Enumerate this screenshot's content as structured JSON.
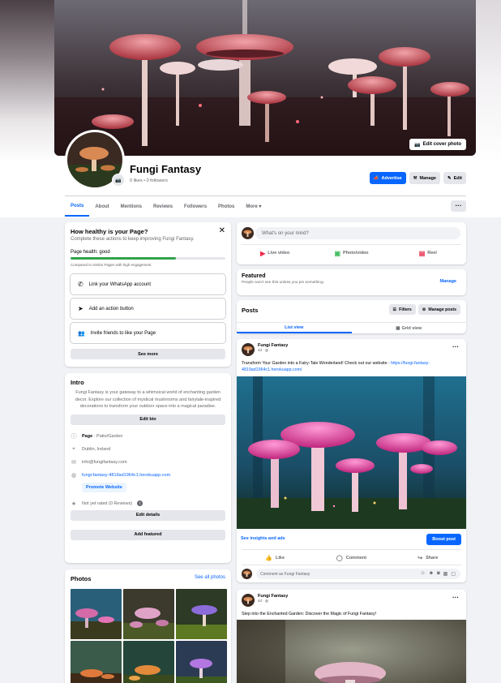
{
  "page": {
    "name": "Fungi Fantasy",
    "stats": "0 likes • 0 followers",
    "edit_cover": "Edit cover photo"
  },
  "header_buttons": {
    "advertise": "Advertise",
    "manage": "Manage",
    "edit": "Edit"
  },
  "tabs": [
    "Posts",
    "About",
    "Mentions",
    "Reviews",
    "Followers",
    "Photos",
    "More"
  ],
  "health": {
    "title": "How healthy is your Page?",
    "subtitle": "Complete these actions to keep improving Fungi Fantasy.",
    "status": "Page health: good",
    "level": 0.68,
    "compare": "Compared to similar Pages with high engagement",
    "actions": [
      "Link your WhatsApp account",
      "Add an action button",
      "Invite friends to like your Page"
    ],
    "see_more": "See more"
  },
  "intro": {
    "title": "Intro",
    "bio": "Fungi Fantasy is your gateway to a whimsical world of enchanting garden decor. Explore our collection of mystical mushrooms and fairytale-inspired decorations to transform your outdoor space into a magical paradise.",
    "edit_bio": "Edit bio",
    "category_label": "Page",
    "category": "Patio/Garden",
    "location": "Dublin, Ireland",
    "email": "info@fungifantasy.com",
    "website": "fungi-fantasy-4819ad1964c1.herokuapp.com",
    "promote": "Promote Website",
    "rating": "Not yet rated (0 Reviews)",
    "edit_details": "Edit details",
    "add_featured": "Add featured"
  },
  "photos": {
    "title": "Photos",
    "see_all": "See all photos"
  },
  "composer": {
    "placeholder": "What's on your mind?",
    "live": "Live video",
    "photo": "Photo/video",
    "reel": "Reel"
  },
  "featured": {
    "title": "Featured",
    "subtitle": "People won't see this unless you pin something.",
    "manage": "Manage"
  },
  "posts_header": {
    "title": "Posts",
    "filters": "Filters",
    "manage_posts": "Manage posts",
    "list_view": "List view",
    "grid_view": "Grid view"
  },
  "posts": [
    {
      "author": "Fungi Fantasy",
      "time": "4d · ",
      "text": "Transform Your Garden into a Fairy-Tale Wonderland! Check out our website : ",
      "link": "https://fungi-fantasy-4819ad1964c1.herokuapp.com/",
      "insights": "See insights and ads",
      "boost": "Boost post",
      "like": "Like",
      "comment": "Comment",
      "share": "Share",
      "comment_placeholder": "Comment as Fungi Fantasy"
    },
    {
      "author": "Fungi Fantasy",
      "time": "4d · ",
      "text": "Step into the Enchanted Garden: Discover the Magic of Fungi Fantasy!"
    }
  ],
  "colors": {
    "accent": "#0866ff",
    "health_good": "#31a24c",
    "background": "#f0f2f5"
  }
}
